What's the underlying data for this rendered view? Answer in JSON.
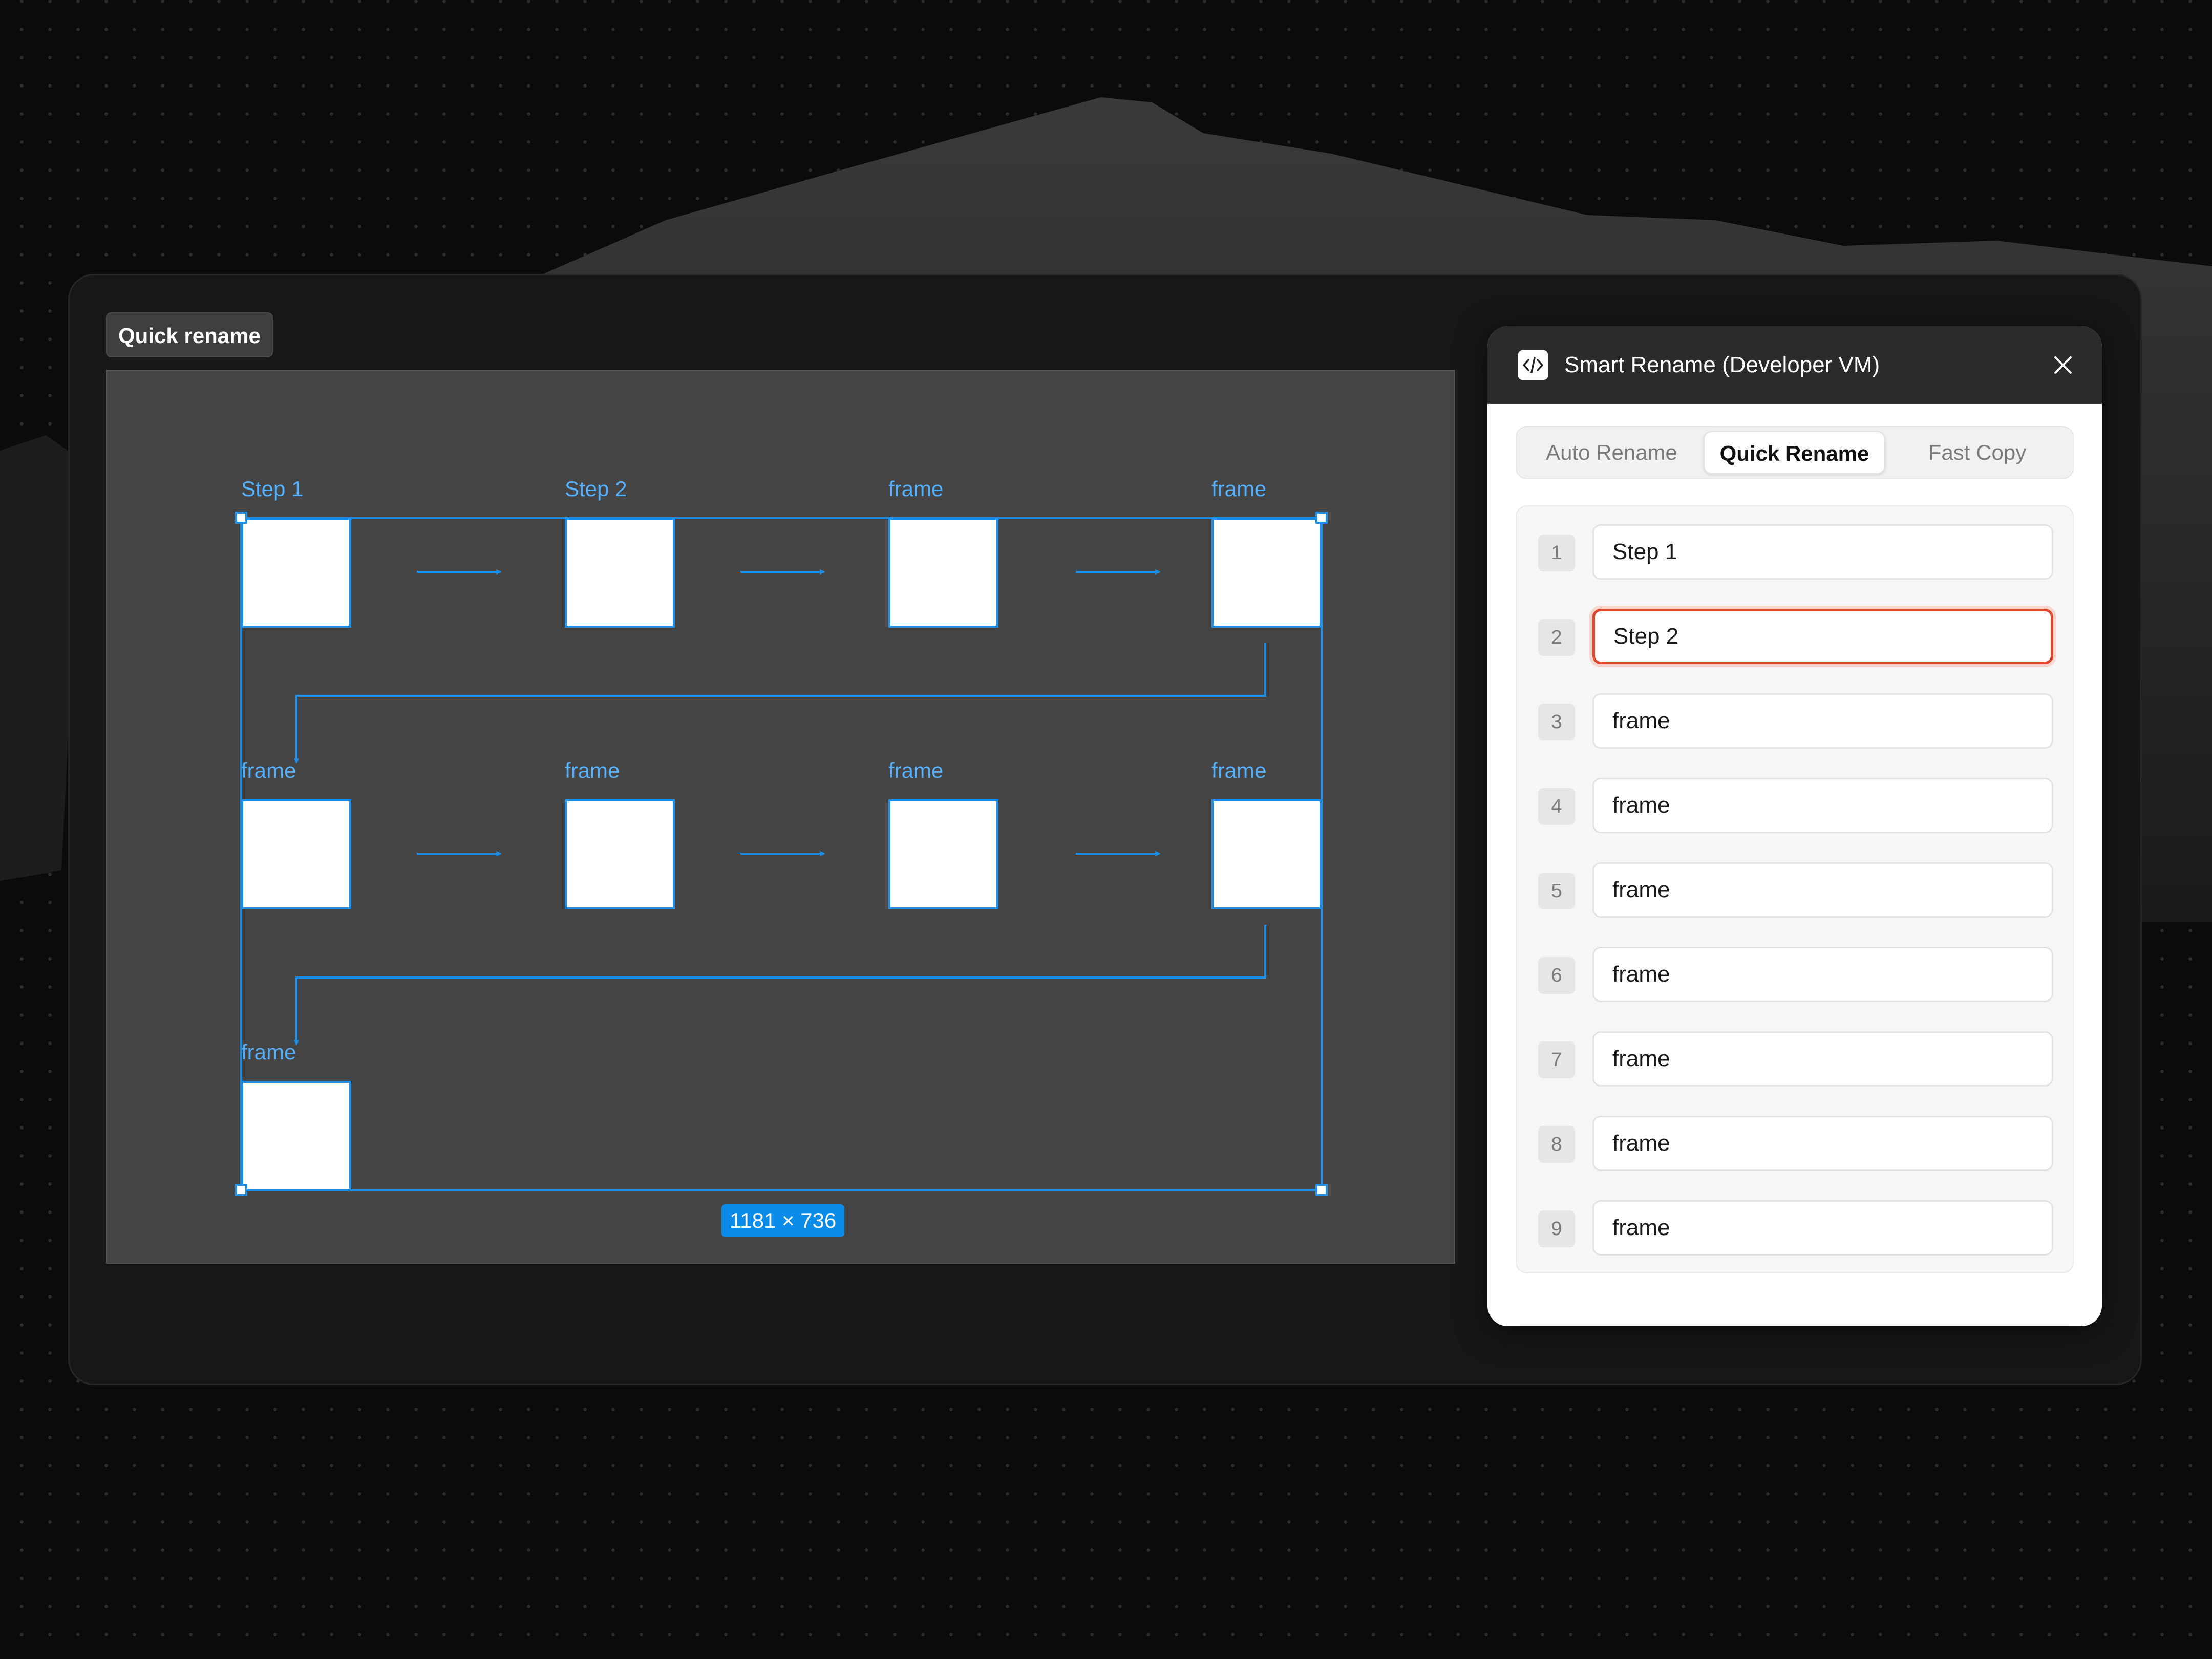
{
  "page_label": "Quick rename",
  "canvas": {
    "frames": [
      {
        "label": "Step 1"
      },
      {
        "label": "Step 2"
      },
      {
        "label": "frame"
      },
      {
        "label": "frame"
      },
      {
        "label": "frame"
      },
      {
        "label": "frame"
      },
      {
        "label": "frame"
      },
      {
        "label": "frame"
      },
      {
        "label": "frame"
      }
    ],
    "dimensions": "1181 × 736",
    "accent_color": "#1d8fe8"
  },
  "plugin": {
    "title": "Smart Rename (Developer VM)",
    "icon": "code-icon",
    "tabs": [
      {
        "label": "Auto Rename",
        "active": false
      },
      {
        "label": "Quick Rename",
        "active": true
      },
      {
        "label": "Fast Copy",
        "active": false
      }
    ],
    "rows": [
      {
        "num": "1",
        "value": "Step 1",
        "focused": false
      },
      {
        "num": "2",
        "value": "Step 2",
        "focused": true
      },
      {
        "num": "3",
        "value": "frame",
        "focused": false
      },
      {
        "num": "4",
        "value": "frame",
        "focused": false
      },
      {
        "num": "5",
        "value": "frame",
        "focused": false
      },
      {
        "num": "6",
        "value": "frame",
        "focused": false
      },
      {
        "num": "7",
        "value": "frame",
        "focused": false
      },
      {
        "num": "8",
        "value": "frame",
        "focused": false
      },
      {
        "num": "9",
        "value": "frame",
        "focused": false
      }
    ],
    "focus_color": "#d94a2f"
  }
}
